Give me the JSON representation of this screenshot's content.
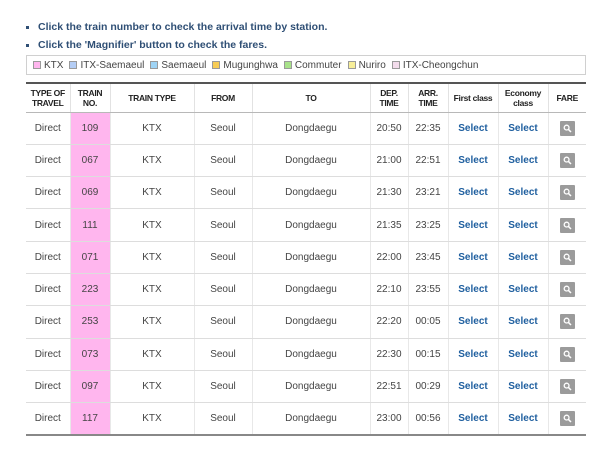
{
  "notes": [
    "Click the train number to check the arrival time by station.",
    "Click the 'Magnifier' button to check the fares."
  ],
  "legend": [
    {
      "label": "KTX",
      "color": "#ffb6ee"
    },
    {
      "label": "ITX-Saemaeul",
      "color": "#b4cdf5"
    },
    {
      "label": "Saemaeul",
      "color": "#9fd4f5"
    },
    {
      "label": "Mugunghwa",
      "color": "#f7cc55"
    },
    {
      "label": "Commuter",
      "color": "#a8e28a"
    },
    {
      "label": "Nuriro",
      "color": "#f7ee99"
    },
    {
      "label": "ITX-Cheongchun",
      "color": "#f3dcec"
    }
  ],
  "table": {
    "headers": {
      "type_line1": "TYPE OF",
      "type_line2": "TRAVEL",
      "no_line1": "TRAIN",
      "no_line2": "NO.",
      "train_type": "TRAIN TYPE",
      "from": "FROM",
      "to": "TO",
      "dep_line1": "DEP.",
      "dep_line2": "TIME",
      "arr_line1": "ARR.",
      "arr_line2": "TIME",
      "first": "First class",
      "econ_line1": "Economy",
      "econ_line2": "class",
      "fare": "FARE"
    },
    "select_label": "Select",
    "rows": [
      {
        "type": "Direct",
        "no": "109",
        "train_type": "KTX",
        "from": "Seoul",
        "to": "Dongdaegu",
        "dep": "20:50",
        "arr": "22:35"
      },
      {
        "type": "Direct",
        "no": "067",
        "train_type": "KTX",
        "from": "Seoul",
        "to": "Dongdaegu",
        "dep": "21:00",
        "arr": "22:51"
      },
      {
        "type": "Direct",
        "no": "069",
        "train_type": "KTX",
        "from": "Seoul",
        "to": "Dongdaegu",
        "dep": "21:30",
        "arr": "23:21"
      },
      {
        "type": "Direct",
        "no": "111",
        "train_type": "KTX",
        "from": "Seoul",
        "to": "Dongdaegu",
        "dep": "21:35",
        "arr": "23:25"
      },
      {
        "type": "Direct",
        "no": "071",
        "train_type": "KTX",
        "from": "Seoul",
        "to": "Dongdaegu",
        "dep": "22:00",
        "arr": "23:45"
      },
      {
        "type": "Direct",
        "no": "223",
        "train_type": "KTX",
        "from": "Seoul",
        "to": "Dongdaegu",
        "dep": "22:10",
        "arr": "23:55"
      },
      {
        "type": "Direct",
        "no": "253",
        "train_type": "KTX",
        "from": "Seoul",
        "to": "Dongdaegu",
        "dep": "22:20",
        "arr": "00:05"
      },
      {
        "type": "Direct",
        "no": "073",
        "train_type": "KTX",
        "from": "Seoul",
        "to": "Dongdaegu",
        "dep": "22:30",
        "arr": "00:15"
      },
      {
        "type": "Direct",
        "no": "097",
        "train_type": "KTX",
        "from": "Seoul",
        "to": "Dongdaegu",
        "dep": "22:51",
        "arr": "00:29"
      },
      {
        "type": "Direct",
        "no": "117",
        "train_type": "KTX",
        "from": "Seoul",
        "to": "Dongdaegu",
        "dep": "23:00",
        "arr": "00:56"
      }
    ]
  },
  "icons": {
    "fare_button": "magnifier-icon"
  }
}
